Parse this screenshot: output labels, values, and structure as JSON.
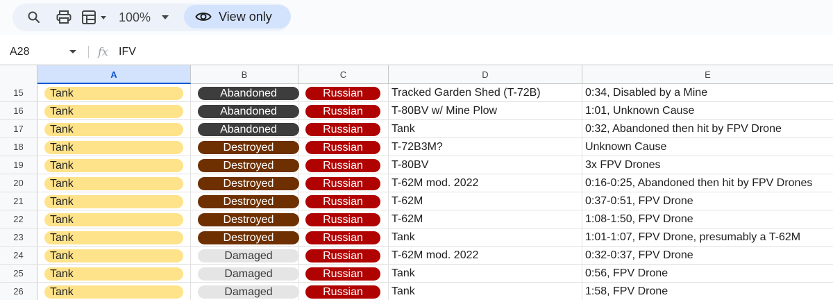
{
  "toolbar": {
    "zoom": "100%",
    "view_only_label": "View only"
  },
  "formula_bar": {
    "cell_ref": "A28",
    "fx": "fx",
    "value": "IFV"
  },
  "columns": [
    "A",
    "B",
    "C",
    "D",
    "E"
  ],
  "colors": {
    "tank_chip": "#ffe38a",
    "abandoned_chip": "#3d3d3d",
    "destroyed_chip": "#6e3000",
    "damaged_chip": "#e5e5e5",
    "russian_chip": "#b10202",
    "selected_header": "#d3e3fd"
  },
  "rows": [
    {
      "num": "15",
      "a": "Tank",
      "b": "Abandoned",
      "b_style": "abandoned",
      "c": "Russian",
      "d": "Tracked Garden Shed (T-72B)",
      "e": "0:34, Disabled by a Mine"
    },
    {
      "num": "16",
      "a": "Tank",
      "b": "Abandoned",
      "b_style": "abandoned",
      "c": "Russian",
      "d": "T-80BV w/ Mine Plow",
      "e": "1:01, Unknown Cause"
    },
    {
      "num": "17",
      "a": "Tank",
      "b": "Abandoned",
      "b_style": "abandoned",
      "c": "Russian",
      "d": "Tank",
      "e": "0:32, Abandoned then hit by FPV Drone"
    },
    {
      "num": "18",
      "a": "Tank",
      "b": "Destroyed",
      "b_style": "destroyed",
      "c": "Russian",
      "d": "T-72B3M?",
      "e": "Unknown Cause"
    },
    {
      "num": "19",
      "a": "Tank",
      "b": "Destroyed",
      "b_style": "destroyed",
      "c": "Russian",
      "d": "T-80BV",
      "e": "3x FPV Drones"
    },
    {
      "num": "20",
      "a": "Tank",
      "b": "Destroyed",
      "b_style": "destroyed",
      "c": "Russian",
      "d": "T-62M mod. 2022",
      "e": "0:16-0:25, Abandoned then hit by FPV Drones"
    },
    {
      "num": "21",
      "a": "Tank",
      "b": "Destroyed",
      "b_style": "destroyed",
      "c": "Russian",
      "d": "T-62M",
      "e": "0:37-0:51, FPV Drone"
    },
    {
      "num": "22",
      "a": "Tank",
      "b": "Destroyed",
      "b_style": "destroyed",
      "c": "Russian",
      "d": "T-62M",
      "e": "1:08-1:50, FPV Drone"
    },
    {
      "num": "23",
      "a": "Tank",
      "b": "Destroyed",
      "b_style": "destroyed",
      "c": "Russian",
      "d": "Tank",
      "e": "1:01-1:07, FPV Drone, presumably a T-62M"
    },
    {
      "num": "24",
      "a": "Tank",
      "b": "Damaged",
      "b_style": "damaged",
      "c": "Russian",
      "d": "T-62M mod. 2022",
      "e": "0:32-0:37, FPV Drone"
    },
    {
      "num": "25",
      "a": "Tank",
      "b": "Damaged",
      "b_style": "damaged",
      "c": "Russian",
      "d": "Tank",
      "e": "0:56, FPV Drone"
    },
    {
      "num": "26",
      "a": "Tank",
      "b": "Damaged",
      "b_style": "damaged",
      "c": "Russian",
      "d": "Tank",
      "e": "1:58, FPV Drone"
    }
  ]
}
